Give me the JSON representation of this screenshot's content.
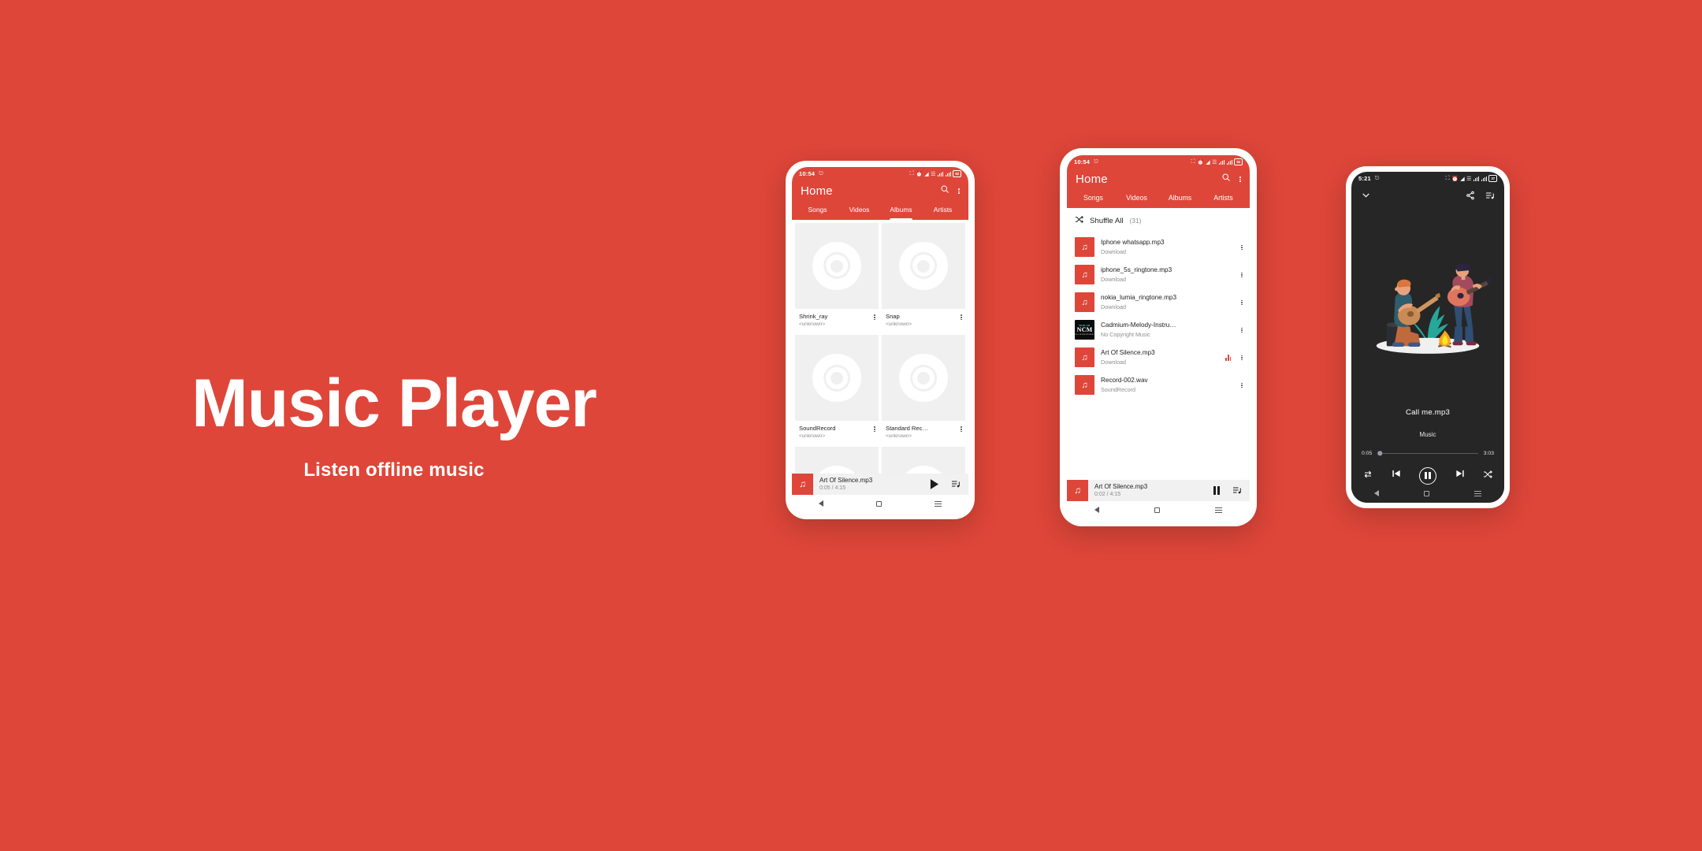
{
  "hero": {
    "title": "Music Player",
    "subtitle": "Listen offline music"
  },
  "colors": {
    "brand_red": "#DE4639",
    "dark_screen": "#262626",
    "list_bg": "#FFFFFF",
    "mini_player_bg": "#F1F1F1"
  },
  "phone1": {
    "status": {
      "time": "10:54",
      "battery": "62"
    },
    "appbar": {
      "title": "Home",
      "search_icon": "search-icon",
      "overflow_icon": "more-vertical-icon"
    },
    "tabs": [
      {
        "label": "Songs",
        "active": false
      },
      {
        "label": "Videos",
        "active": false
      },
      {
        "label": "Albums",
        "active": true
      },
      {
        "label": "Artists",
        "active": false
      }
    ],
    "albums": [
      {
        "name": "Shrink_ray",
        "artist": "<unknown>"
      },
      {
        "name": "Snap",
        "artist": "<unknown>"
      },
      {
        "name": "SoundRecord",
        "artist": "<unknown>"
      },
      {
        "name": "Standard Rec…",
        "artist": "<unknown>"
      },
      {
        "name": "",
        "artist": ""
      },
      {
        "name": "",
        "artist": ""
      }
    ],
    "mini_player": {
      "title": "Art Of Silence.mp3",
      "time": "0:05 / 4:15",
      "play_state": "play",
      "queue_icon": "playlist-icon"
    },
    "navbar": {
      "back": "back-icon",
      "home": "home-icon",
      "recents": "recents-icon"
    }
  },
  "phone2": {
    "status": {
      "time": "10:54",
      "battery": "62"
    },
    "appbar": {
      "title": "Home",
      "search_icon": "search-icon",
      "overflow_icon": "more-vertical-icon"
    },
    "tabs": [
      {
        "label": "Songs",
        "active": true
      },
      {
        "label": "Videos",
        "active": false
      },
      {
        "label": "Albums",
        "active": false
      },
      {
        "label": "Artists",
        "active": false
      }
    ],
    "shuffle": {
      "label": "Shuffle All",
      "count": "(31)",
      "icon": "shuffle-icon"
    },
    "songs": [
      {
        "title": "Iphone whatsapp.mp3",
        "sub": "Download",
        "art": "music-note",
        "playing": false
      },
      {
        "title": "iphone_5s_ringtone.mp3",
        "sub": "Download",
        "art": "music-note",
        "playing": false
      },
      {
        "title": "nokia_lumia_ringtone.mp3",
        "sub": "Download",
        "art": "music-note",
        "playing": false
      },
      {
        "title": "Cadmium-Melody-Instru…",
        "sub": "No Copyright Music",
        "art": "ncm-cover",
        "playing": false
      },
      {
        "title": "Art Of Silence.mp3",
        "sub": "Download",
        "art": "music-note",
        "playing": true
      },
      {
        "title": "Record-002.wav",
        "sub": "SoundRecord",
        "art": "music-note",
        "playing": false
      }
    ],
    "ncm_cover": {
      "top": "ncm.su",
      "mid": "NCM",
      "bot": "NO COPYRIGHT MUSIC"
    },
    "mini_player": {
      "title": "Art Of Silence.mp3",
      "time": "0:02 / 4:15",
      "play_state": "pause",
      "queue_icon": "playlist-icon"
    },
    "navbar": {
      "back": "back-icon",
      "home": "home-icon",
      "recents": "recents-icon"
    }
  },
  "phone3": {
    "status": {
      "time": "5:21",
      "battery": "37"
    },
    "topbar": {
      "collapse_icon": "chevron-down-icon",
      "share_icon": "share-icon",
      "queue_icon": "playlist-icon"
    },
    "artwork": "campfire-guitarists-illustration",
    "now_playing": {
      "song": "Call me.mp3",
      "artist": "Music"
    },
    "seek": {
      "current": "0:05",
      "total": "3:03",
      "progress_percent": 2.5
    },
    "controls": {
      "repeat_icon": "repeat-icon",
      "previous_icon": "skip-previous-icon",
      "play_state": "pause",
      "next_icon": "skip-next-icon",
      "shuffle_icon": "shuffle-icon"
    },
    "navbar": {
      "back": "back-icon",
      "home": "home-icon",
      "recents": "recents-icon"
    }
  }
}
